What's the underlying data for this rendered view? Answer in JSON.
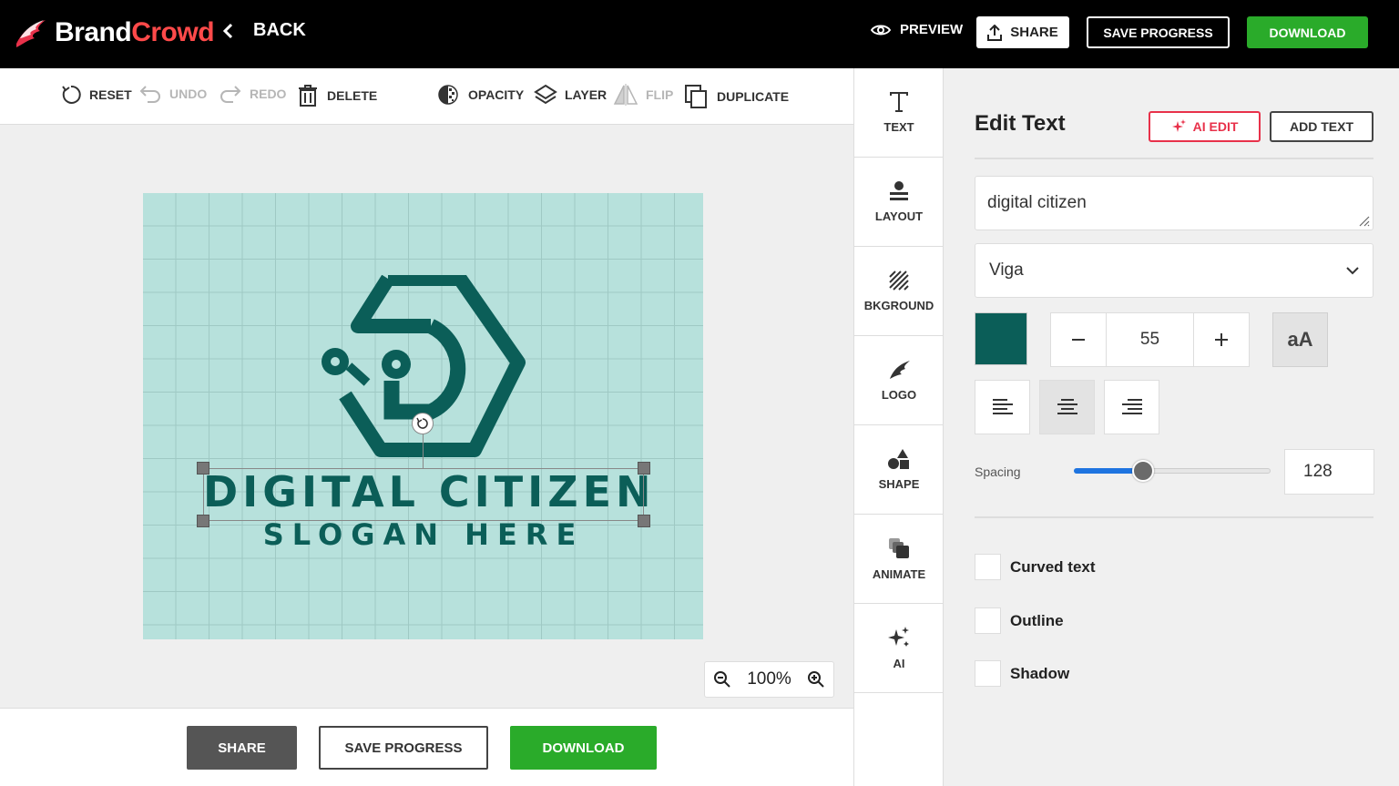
{
  "topbar": {
    "brand_part1": "Brand",
    "brand_part2": "Crowd",
    "back_label": "BACK",
    "preview_label": "PREVIEW",
    "share_label": "SHARE",
    "save_label": "SAVE PROGRESS",
    "download_label": "DOWNLOAD"
  },
  "toolbar": {
    "reset": "RESET",
    "undo": "UNDO",
    "redo": "REDO",
    "delete": "DELETE",
    "opacity": "OPACITY",
    "layer": "LAYER",
    "flip": "FLIP",
    "duplicate": "DUPLICATE"
  },
  "canvas": {
    "headline": "DIGITAL CITIZEN",
    "slogan": "SLOGAN HERE",
    "zoom_level": "100%",
    "logo_color": "#0b5e58",
    "background_color": "#b7e1dc"
  },
  "bottombar": {
    "share_label": "SHARE",
    "save_label": "SAVE PROGRESS",
    "download_label": "DOWNLOAD"
  },
  "sidenav": {
    "items": [
      {
        "label": "TEXT",
        "icon": "text-icon"
      },
      {
        "label": "LAYOUT",
        "icon": "layout-icon"
      },
      {
        "label": "BKGROUND",
        "icon": "background-icon"
      },
      {
        "label": "LOGO",
        "icon": "logo-icon"
      },
      {
        "label": "SHAPE",
        "icon": "shape-icon"
      },
      {
        "label": "ANIMATE",
        "icon": "animate-icon"
      },
      {
        "label": "AI",
        "icon": "ai-sparkle-icon"
      }
    ]
  },
  "panel": {
    "title": "Edit Text",
    "ai_edit_label": "AI EDIT",
    "add_text_label": "ADD TEXT",
    "text_value": "digital citizen",
    "font": "Viga",
    "color": "#0b5e58",
    "font_size": "55",
    "case_label": "aA",
    "alignment": "center",
    "spacing_label": "Spacing",
    "spacing_value": "128",
    "spacing_fraction": 0.35,
    "options": [
      {
        "label": "Curved text",
        "checked": false
      },
      {
        "label": "Outline",
        "checked": false
      },
      {
        "label": "Shadow",
        "checked": false
      }
    ]
  },
  "colors": {
    "accent_green": "#2aab2a",
    "ai_red": "#e8314a",
    "slider_blue": "#1e74e0"
  }
}
